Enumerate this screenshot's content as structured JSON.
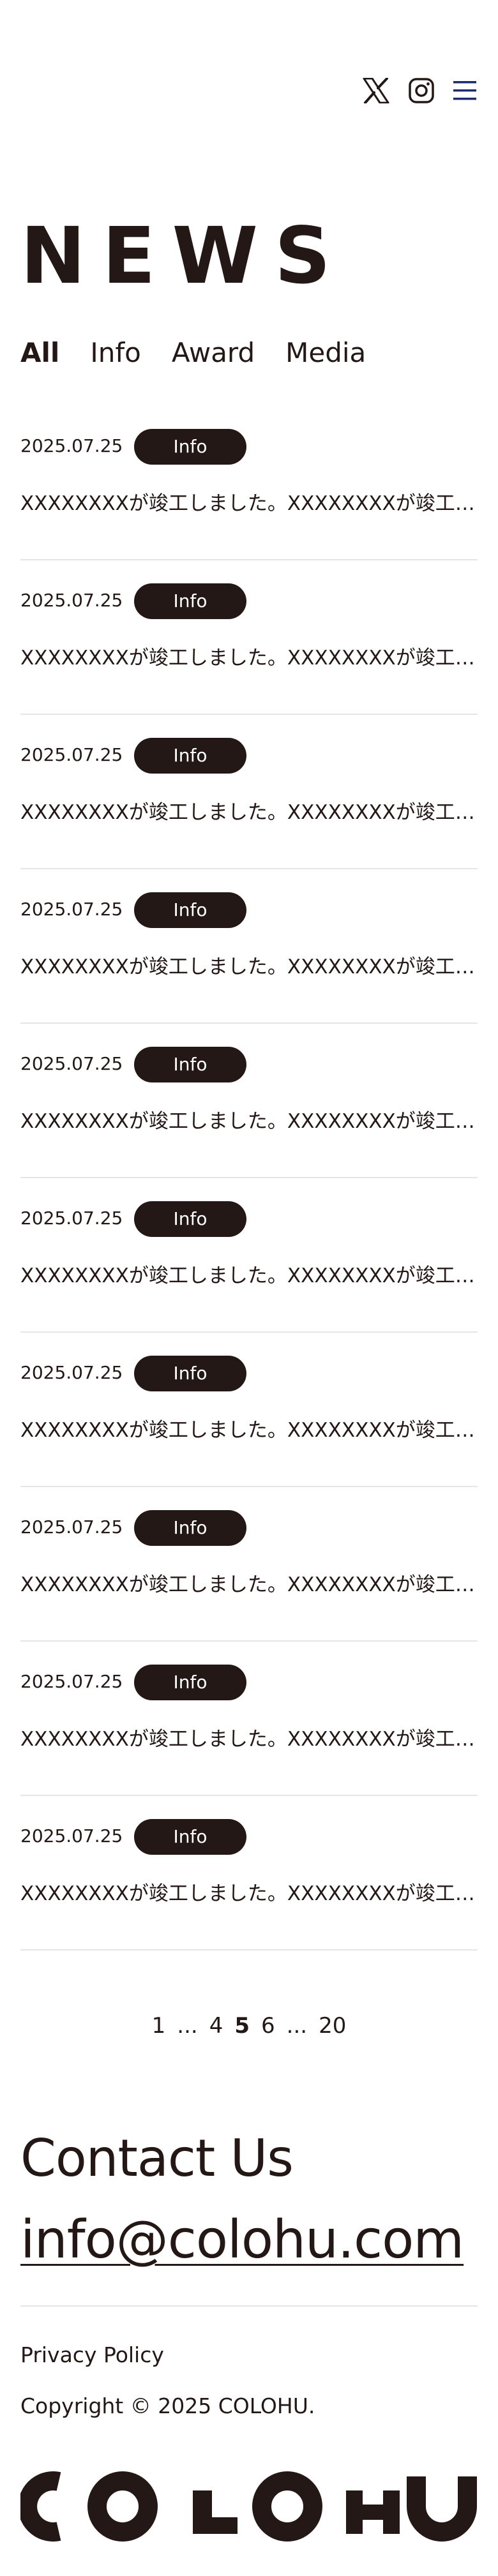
{
  "header": {
    "icons": [
      {
        "name": "x-logo-icon",
        "label": "X"
      },
      {
        "name": "instagram-icon",
        "label": "Instagram"
      },
      {
        "name": "hamburger-menu-icon",
        "label": "Menu"
      }
    ],
    "menu_color": "#1d2d6b"
  },
  "page_title": "NEWS",
  "tabs": [
    {
      "label": "All",
      "active": true
    },
    {
      "label": "Info",
      "active": false
    },
    {
      "label": "Award",
      "active": false
    },
    {
      "label": "Media",
      "active": false
    }
  ],
  "news": [
    {
      "date": "2025.07.25",
      "category": "Info",
      "title": "XXXXXXXXが竣工しました。XXXXXXXXが竣工しました。"
    },
    {
      "date": "2025.07.25",
      "category": "Info",
      "title": "XXXXXXXXが竣工しました。XXXXXXXXが竣工しました。"
    },
    {
      "date": "2025.07.25",
      "category": "Info",
      "title": "XXXXXXXXが竣工しました。XXXXXXXXが竣工しました。"
    },
    {
      "date": "2025.07.25",
      "category": "Info",
      "title": "XXXXXXXXが竣工しました。XXXXXXXXが竣工しました。"
    },
    {
      "date": "2025.07.25",
      "category": "Info",
      "title": "XXXXXXXXが竣工しました。XXXXXXXXが竣工しました。"
    },
    {
      "date": "2025.07.25",
      "category": "Info",
      "title": "XXXXXXXXが竣工しました。XXXXXXXXが竣工しました。"
    },
    {
      "date": "2025.07.25",
      "category": "Info",
      "title": "XXXXXXXXが竣工しました。XXXXXXXXが竣工しました。"
    },
    {
      "date": "2025.07.25",
      "category": "Info",
      "title": "XXXXXXXXが竣工しました。XXXXXXXXが竣工しました。"
    },
    {
      "date": "2025.07.25",
      "category": "Info",
      "title": "XXXXXXXXが竣工しました。XXXXXXXXが竣工しました。"
    },
    {
      "date": "2025.07.25",
      "category": "Info",
      "title": "XXXXXXXXが竣工しました。XXXXXXXXが竣工しました。"
    }
  ],
  "pagination": [
    {
      "label": "1",
      "type": "page",
      "current": false
    },
    {
      "label": "...",
      "type": "ellipsis",
      "current": false
    },
    {
      "label": "4",
      "type": "page",
      "current": false
    },
    {
      "label": "5",
      "type": "page",
      "current": true
    },
    {
      "label": "6",
      "type": "page",
      "current": false
    },
    {
      "label": "...",
      "type": "ellipsis",
      "current": false
    },
    {
      "label": "20",
      "type": "page",
      "current": false
    }
  ],
  "contact": {
    "heading": "Contact Us",
    "email": "info@colohu.com"
  },
  "footer": {
    "privacy_label": "Privacy Policy",
    "copyright": "Copyright © 2025 COLOHU.",
    "logo_text": "COLOHU"
  },
  "colors": {
    "text": "#231815",
    "badge_bg": "#231815",
    "badge_text": "#ffffff",
    "divider": "#e6e6e6"
  }
}
